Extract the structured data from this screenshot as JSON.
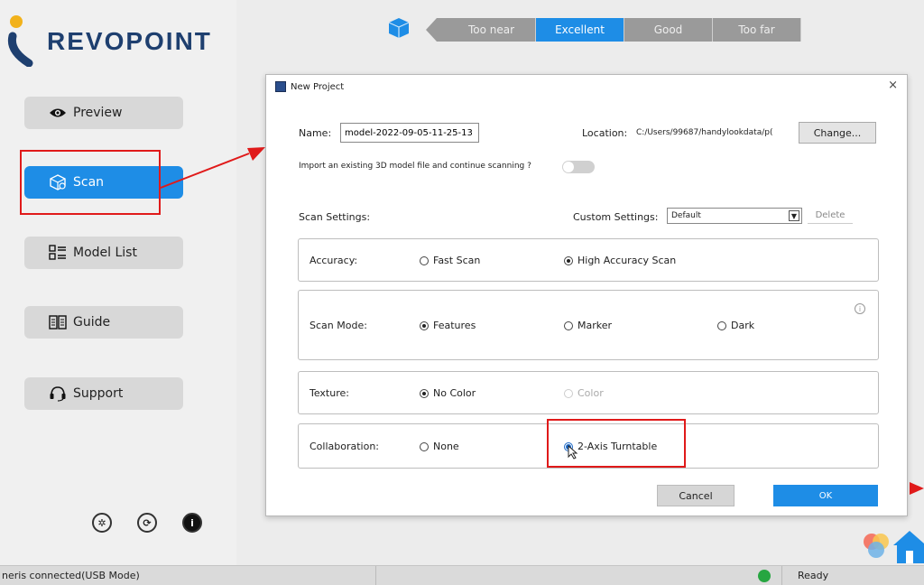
{
  "app": {
    "logo_text": "REVOPOINT"
  },
  "sidebar": {
    "items": [
      {
        "label": "Preview"
      },
      {
        "label": "Scan"
      },
      {
        "label": "Model List"
      },
      {
        "label": "Guide"
      },
      {
        "label": "Support"
      }
    ],
    "active_index": 1
  },
  "distance_bar": {
    "segments": [
      "Too near",
      "Excellent",
      "Good",
      "Too far"
    ],
    "active": "Excellent"
  },
  "dialog": {
    "title": "New Project",
    "close_glyph": "×",
    "name_label": "Name:",
    "name_value": "model-2022-09-05-11-25-13",
    "location_label": "Location:",
    "location_value": "C:/Users/99687/handylookdata/p(",
    "change_label": "Change...",
    "import_question": "Import an existing 3D model file and continue scanning ?",
    "scan_settings_label": "Scan Settings:",
    "custom_settings_label": "Custom Settings:",
    "custom_settings_value": "Default",
    "delete_label": "Delete",
    "accuracy": {
      "label": "Accuracy:",
      "options": [
        "Fast Scan",
        "High Accuracy Scan"
      ],
      "selected": "High Accuracy Scan"
    },
    "scan_mode": {
      "label": "Scan Mode:",
      "options": [
        "Features",
        "Marker",
        "Dark"
      ],
      "selected": "Features"
    },
    "texture": {
      "label": "Texture:",
      "options": [
        "No Color",
        "Color"
      ],
      "selected": "No Color"
    },
    "collaboration": {
      "label": "Collaboration:",
      "options": [
        "None",
        "2-Axis Turntable"
      ],
      "selected": "2-Axis Turntable"
    },
    "cancel_label": "Cancel",
    "ok_label": "OK"
  },
  "statusbar": {
    "connection_text": "neris connected(USB Mode)",
    "ready_text": "Ready"
  },
  "colors": {
    "accent": "#1e8de6",
    "highlight_red": "#e01a1a",
    "logo_blue": "#1e3f6f",
    "status_green": "#27a641"
  }
}
